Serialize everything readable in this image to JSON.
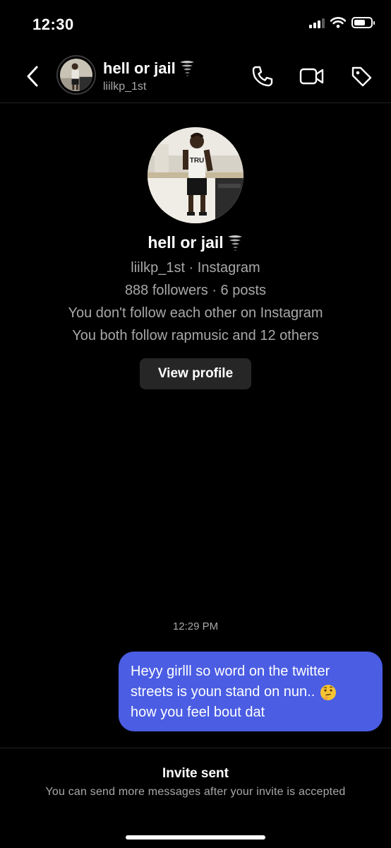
{
  "status_bar": {
    "time": "12:30"
  },
  "header": {
    "name": "hell or jail",
    "name_emoji": "tornado",
    "handle": "liilkp_1st",
    "icons": {
      "back": "chevron-left-icon",
      "call": "phone-icon",
      "video": "video-camera-icon",
      "tag": "tag-icon"
    }
  },
  "profile": {
    "name": "hell or jail",
    "name_emoji": "tornado",
    "handle_line": "liilkp_1st · Instagram",
    "stats_line": "888 followers · 6 posts",
    "follow_status": "You don't follow each other on Instagram",
    "mutual": "You both follow rapmusic and 12 others",
    "view_profile_label": "View profile"
  },
  "chat": {
    "timestamp": "12:29 PM",
    "messages": [
      {
        "sender": "me",
        "lines": [
          "Heyy girlll so word on the twitter",
          "streets is youn stand on nun..",
          "how you feel bout dat"
        ],
        "emoji": "thinking-face"
      }
    ]
  },
  "footer": {
    "title": "Invite sent",
    "subtitle": "You can send more messages after your invite is accepted"
  },
  "colors": {
    "background": "#000000",
    "bubble": "#4a5de3",
    "secondary_text": "#a8a8a8",
    "button_bg": "#262626"
  }
}
